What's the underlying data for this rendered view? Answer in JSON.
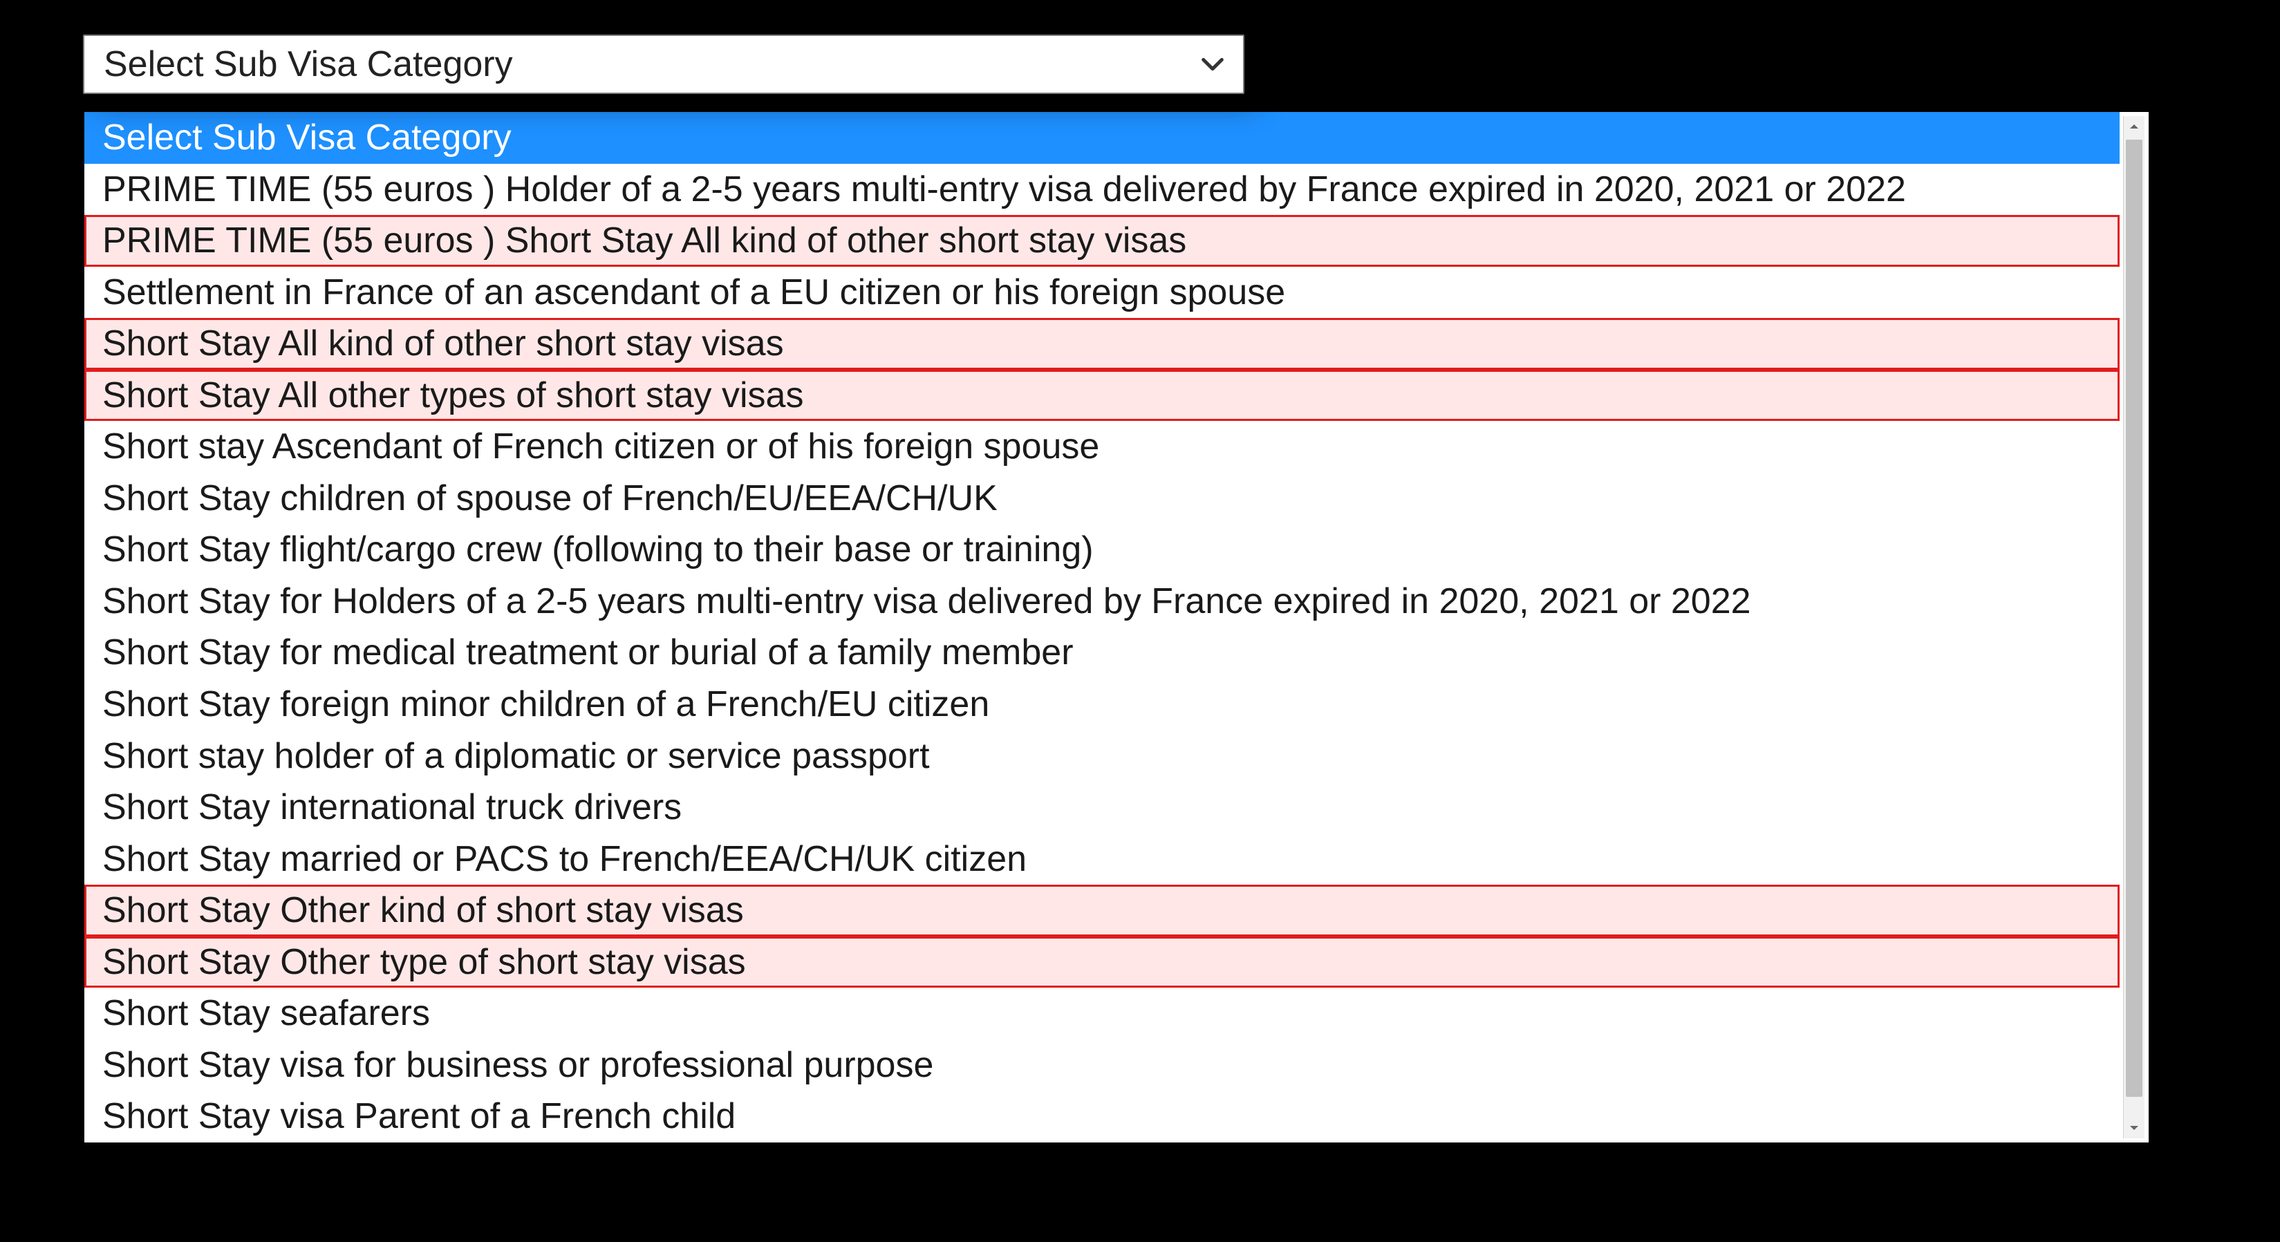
{
  "select": {
    "current_label": "Select Sub Visa Category"
  },
  "dropdown": {
    "options": [
      {
        "label": "Select Sub Visa Category",
        "selected": true,
        "highlight": false
      },
      {
        "label": "PRIME TIME (55 euros ) Holder of a 2-5 years multi-entry visa delivered by France expired in 2020, 2021 or 2022",
        "selected": false,
        "highlight": false
      },
      {
        "label": "PRIME TIME (55 euros ) Short Stay All kind of other short stay visas",
        "selected": false,
        "highlight": true
      },
      {
        "label": "Settlement in France of an ascendant of a EU citizen or his foreign spouse",
        "selected": false,
        "highlight": false
      },
      {
        "label": "Short Stay All kind of other short stay visas",
        "selected": false,
        "highlight": true
      },
      {
        "label": "Short Stay All other types of short stay visas",
        "selected": false,
        "highlight": true
      },
      {
        "label": "Short stay Ascendant of French citizen or of his foreign spouse",
        "selected": false,
        "highlight": false
      },
      {
        "label": "Short Stay children of spouse of French/EU/EEA/CH/UK",
        "selected": false,
        "highlight": false
      },
      {
        "label": "Short Stay flight/cargo crew (following to their base or training)",
        "selected": false,
        "highlight": false
      },
      {
        "label": "Short Stay for Holders of a 2-5 years multi-entry visa delivered by France expired in 2020, 2021 or 2022",
        "selected": false,
        "highlight": false
      },
      {
        "label": "Short Stay for medical treatment or burial of a family member",
        "selected": false,
        "highlight": false
      },
      {
        "label": "Short Stay foreign minor children of a French/EU citizen",
        "selected": false,
        "highlight": false
      },
      {
        "label": "Short stay holder of a diplomatic or service passport",
        "selected": false,
        "highlight": false
      },
      {
        "label": "Short Stay international truck drivers",
        "selected": false,
        "highlight": false
      },
      {
        "label": "Short Stay married or PACS to French/EEA/CH/UK citizen",
        "selected": false,
        "highlight": false
      },
      {
        "label": "Short Stay Other kind of short stay visas",
        "selected": false,
        "highlight": true
      },
      {
        "label": "Short Stay Other type of short stay visas",
        "selected": false,
        "highlight": true
      },
      {
        "label": "Short Stay seafarers",
        "selected": false,
        "highlight": false
      },
      {
        "label": "Short Stay visa for business or professional purpose",
        "selected": false,
        "highlight": false
      },
      {
        "label": "Short Stay visa Parent of a French child",
        "selected": false,
        "highlight": false
      }
    ]
  }
}
